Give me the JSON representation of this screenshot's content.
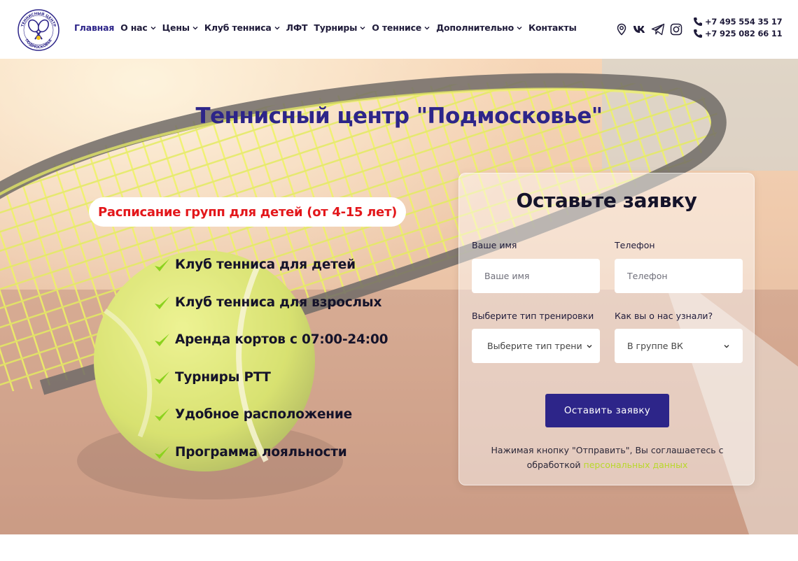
{
  "colors": {
    "brand": "#2d2589",
    "accent_red": "#e3171b",
    "check_green": "#8bd21e",
    "link_lime": "#b8d82b"
  },
  "logo": {
    "text_top": "ТЕННИСНЫЙ ЦЕНТР",
    "text_bottom": "ПОДМОСКОВЬЕ",
    "icon": "crossed-rackets-icon"
  },
  "nav": {
    "items": [
      {
        "label": "Главная",
        "dropdown": false,
        "active": true
      },
      {
        "label": "О нас",
        "dropdown": true
      },
      {
        "label": "Цены",
        "dropdown": true
      },
      {
        "label": "Клуб тенниса",
        "dropdown": true
      },
      {
        "label": "ЛФТ",
        "dropdown": false
      },
      {
        "label": "Турниры",
        "dropdown": true
      },
      {
        "label": "О теннисе",
        "dropdown": true
      },
      {
        "label": "Дополнительно",
        "dropdown": true
      },
      {
        "label": "Контакты",
        "dropdown": false
      }
    ]
  },
  "socials": [
    "map-pin-icon",
    "vk-icon",
    "telegram-icon",
    "instagram-icon"
  ],
  "phones": [
    "+7 495 554 35 17",
    "+7 925 082 66 11"
  ],
  "hero": {
    "title": "Теннисный центр \"Подмосковье\"",
    "schedule_link": "Расписание групп для детей (от 4-15 лет)",
    "features": [
      "Клуб тенниса для детей",
      "Клуб тенниса для взрослых",
      "Аренда кортов с 07:00-24:00",
      "Турниры РТТ",
      "Удобное расположение",
      "Программа лояльности"
    ]
  },
  "form": {
    "title": "Оставьте заявку",
    "name_label": "Ваше имя",
    "name_placeholder": "Ваше имя",
    "phone_label": "Телефон",
    "phone_placeholder": "Телефон",
    "training_label": "Выберите тип тренировки",
    "training_value": "Выберите тип трени",
    "source_label": "Как вы о нас узнали?",
    "source_value": "В группе ВК",
    "submit": "Оставить заявку",
    "consent_text": "Нажимая кнопку \"Отправить\", Вы соглашаетесь с обработкой",
    "consent_link": "персональных данных"
  }
}
